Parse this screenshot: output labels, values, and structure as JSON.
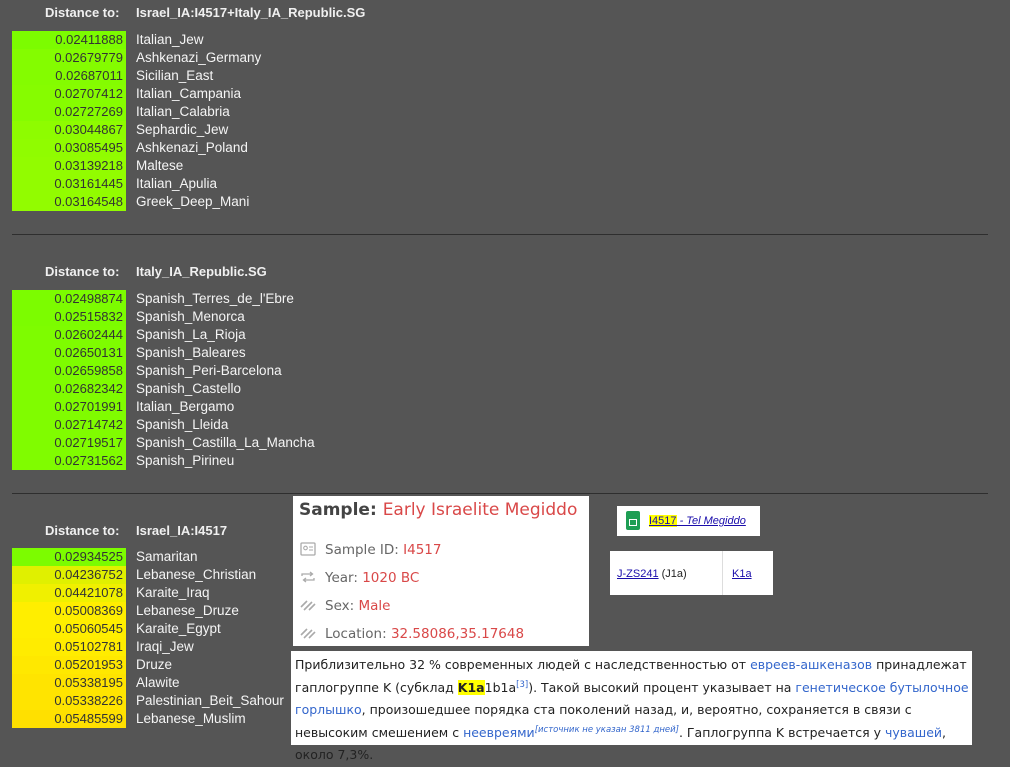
{
  "sections": [
    {
      "label": "Distance to:",
      "target": "Israel_IA:I4517+Italy_IA_Republic.SG",
      "rows": [
        {
          "value": "0.02411888",
          "pop": "Italian_Jew",
          "color": "#7cfc00"
        },
        {
          "value": "0.02679779",
          "pop": "Ashkenazi_Germany",
          "color": "#84fc00"
        },
        {
          "value": "0.02687011",
          "pop": "Sicilian_East",
          "color": "#84fc00"
        },
        {
          "value": "0.02707412",
          "pop": "Italian_Campania",
          "color": "#86fc00"
        },
        {
          "value": "0.02727269",
          "pop": "Italian_Calabria",
          "color": "#86fc00"
        },
        {
          "value": "0.03044867",
          "pop": "Sephardic_Jew",
          "color": "#8efc00"
        },
        {
          "value": "0.03085495",
          "pop": "Ashkenazi_Poland",
          "color": "#90fc00"
        },
        {
          "value": "0.03139218",
          "pop": "Maltese",
          "color": "#92fc00"
        },
        {
          "value": "0.03161445",
          "pop": "Italian_Apulia",
          "color": "#92fc00"
        },
        {
          "value": "0.03164548",
          "pop": "Greek_Deep_Mani",
          "color": "#92fc00"
        }
      ]
    },
    {
      "label": "Distance to:",
      "target": "Italy_IA_Republic.SG",
      "rows": [
        {
          "value": "0.02498874",
          "pop": "Spanish_Terres_de_l'Ebre",
          "color": "#7cfc00"
        },
        {
          "value": "0.02515832",
          "pop": "Spanish_Menorca",
          "color": "#7cfc00"
        },
        {
          "value": "0.02602444",
          "pop": "Spanish_La_Rioja",
          "color": "#7efc00"
        },
        {
          "value": "0.02650131",
          "pop": "Spanish_Baleares",
          "color": "#7efc00"
        },
        {
          "value": "0.02659858",
          "pop": "Spanish_Peri-Barcelona",
          "color": "#7efc00"
        },
        {
          "value": "0.02682342",
          "pop": "Spanish_Castello",
          "color": "#80fc00"
        },
        {
          "value": "0.02701991",
          "pop": "Italian_Bergamo",
          "color": "#80fc00"
        },
        {
          "value": "0.02714742",
          "pop": "Spanish_Lleida",
          "color": "#80fc00"
        },
        {
          "value": "0.02719517",
          "pop": "Spanish_Castilla_La_Mancha",
          "color": "#80fc00"
        },
        {
          "value": "0.02731562",
          "pop": "Spanish_Pirineu",
          "color": "#80fc00"
        }
      ]
    },
    {
      "label": "Distance to:",
      "target": "Israel_IA:I4517",
      "rows": [
        {
          "value": "0.02934525",
          "pop": "Samaritan",
          "color": "#7cfc00"
        },
        {
          "value": "0.04236752",
          "pop": "Lebanese_Christian",
          "color": "#e0f000"
        },
        {
          "value": "0.04421078",
          "pop": "Karaite_Iraq",
          "color": "#f0f000"
        },
        {
          "value": "0.05008369",
          "pop": "Lebanese_Druze",
          "color": "#ffee00"
        },
        {
          "value": "0.05060545",
          "pop": "Karaite_Egypt",
          "color": "#ffee00"
        },
        {
          "value": "0.05102781",
          "pop": "Iraqi_Jew",
          "color": "#ffec00"
        },
        {
          "value": "0.05201953",
          "pop": "Druze",
          "color": "#ffe800"
        },
        {
          "value": "0.05338195",
          "pop": "Alawite",
          "color": "#ffe400"
        },
        {
          "value": "0.05338226",
          "pop": "Palestinian_Beit_Sahour",
          "color": "#ffe400"
        },
        {
          "value": "0.05485599",
          "pop": "Lebanese_Muslim",
          "color": "#ffe000"
        }
      ]
    }
  ],
  "sample_card": {
    "title_label": "Sample:",
    "title_value": "Early Israelite Megiddo",
    "lines": [
      {
        "icon": "id-card-icon",
        "label": "Sample ID: ",
        "value": "I4517"
      },
      {
        "icon": "repeat-icon",
        "label": "Year: ",
        "value": "1020 BC"
      },
      {
        "icon": "stripes-icon",
        "label": "Sex: ",
        "value": "Male"
      },
      {
        "icon": "stripes-icon",
        "label": "Location: ",
        "value": "32.58086,35.17648"
      }
    ]
  },
  "link_box": {
    "icon": "google-sheets-icon",
    "highlight": "I4517",
    "rest": " - Tel Megiddo"
  },
  "hap_table": {
    "y_link": "J-ZS241",
    "y_note": " (J1a)",
    "mt_link": "K1a"
  },
  "wiki": {
    "t1": "Приблизительно 32 % современных людей с наследственностью от ",
    "l1": "евреев-ашкеназов",
    "t2": " принадлежат гаплогруппе K (субклад ",
    "k1a": "K1a",
    "t3": "1b1a",
    "ref": "[3]",
    "t4": "). Такой высокий процент указывает на ",
    "l2": "генетическое бутылочное горлышко",
    "t5": ", произошедшее порядка ста поколений назад, и, вероятно, сохраняется в связи с невысоким смешением с ",
    "l3": "неевреями",
    "cn": "[источник не указан 3811 дней]",
    "t6": ". Гаплогруппа K встречается у ",
    "l4": "чувашей",
    "t7": ", около 7,3%."
  }
}
